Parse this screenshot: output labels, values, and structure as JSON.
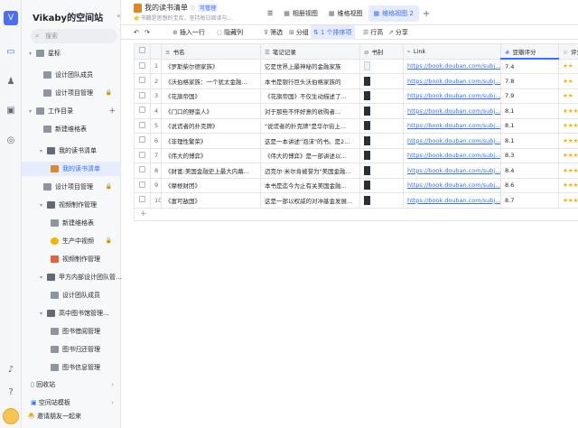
{
  "workspace": {
    "initial": "V",
    "title": "Vikaby的空间站",
    "search_placeholder": "搜索"
  },
  "sidebar": {
    "items": [
      {
        "label": "星标",
        "level": 0,
        "type": "group"
      },
      {
        "label": "设计团队成员",
        "level": 1,
        "type": "table"
      },
      {
        "label": "设计项目管理",
        "level": 1,
        "type": "table",
        "locked": true
      },
      {
        "label": "工作目录",
        "level": 0,
        "type": "group"
      },
      {
        "label": "新建维格表",
        "level": 1,
        "type": "table"
      },
      {
        "label": "我的读书清单",
        "level": 1,
        "type": "folder"
      },
      {
        "label": "我的读书清单",
        "level": 2,
        "type": "book",
        "selected": true
      },
      {
        "label": "设计项目管理",
        "level": 1,
        "type": "table",
        "locked": true
      },
      {
        "label": "视频制作管理",
        "level": 1,
        "type": "folder"
      },
      {
        "label": "新建维格表",
        "level": 2,
        "type": "table"
      },
      {
        "label": "生产中视频",
        "level": 2,
        "type": "emoji",
        "locked": true
      },
      {
        "label": "视频制作管理",
        "level": 2,
        "type": "thumb"
      },
      {
        "label": "甲方内部设计团队管...",
        "level": 1,
        "type": "folder"
      },
      {
        "label": "设计团队成员",
        "level": 2,
        "type": "table"
      },
      {
        "label": "高中图书馆管理...",
        "level": 1,
        "type": "folder"
      },
      {
        "label": "图书借阅管理",
        "level": 2,
        "type": "table"
      },
      {
        "label": "图书归还管理",
        "level": 2,
        "type": "table"
      },
      {
        "label": "图书信息管理",
        "level": 2,
        "type": "table"
      }
    ],
    "recycle_bin": "回收站",
    "templates": "空间站模板",
    "invite": "邀请朋友一起来"
  },
  "header": {
    "datasheet_name": "我的读书清单",
    "badge": "可管理",
    "description": "👉书籍是思想的宝库，坚持每日阅读与..."
  },
  "tabs": [
    {
      "label": "相册视图",
      "icon": "▦"
    },
    {
      "label": "维格视图",
      "icon": "▦"
    },
    {
      "label": "维格视图 2",
      "icon": "▦",
      "active": true
    }
  ],
  "toolbar": {
    "insert_row": "插入一行",
    "hidden_fields": "隐藏列",
    "filter": "筛选",
    "group": "分组",
    "sort": "1 个排序项",
    "row_height": "行高",
    "share": "分享"
  },
  "columns": [
    "书名",
    "笔记记录",
    "书封",
    "Link",
    "豆瓣评分",
    "评分"
  ],
  "rows": [
    {
      "n": "1",
      "title": "《罗斯柴尔德家族》",
      "note": "它是世界上最神秘的金融家族",
      "link": "https://book.douban.com/subj...",
      "score": "7.4",
      "stars": "★★",
      "cover": "c0"
    },
    {
      "n": "2",
      "title": "《沃伯格家族：一个犹太金融...",
      "note": "本书是银行巨头沃伯格家族的",
      "link": "https://book.douban.com/subj...",
      "score": "7.8",
      "stars": "★★",
      "cover": "c1"
    },
    {
      "n": "3",
      "title": "《花旗帝国》",
      "note": "《花旗帝国》不仅生动描述了...",
      "link": "https://book.douban.com/subj...",
      "score": "7.9",
      "stars": "★★",
      "cover": "c1"
    },
    {
      "n": "4",
      "title": "《门口的野蛮人》",
      "note": "对于那些不怀好意的收购者...",
      "link": "https://book.douban.com/subj...",
      "score": "8.1",
      "stars": "★★★",
      "cover": "c1"
    },
    {
      "n": "5",
      "title": "《说谎者的扑克牌》",
      "note": "\"说谎者的扑克牌\"是华尔街上...",
      "link": "https://book.douban.com/subj...",
      "score": "8.1",
      "stars": "★★★",
      "cover": "c1"
    },
    {
      "n": "6",
      "title": "《非理性繁荣》",
      "note": "这是一本讲述\"泡沫\"的书。是2...",
      "link": "https://book.douban.com/subj...",
      "score": "8.1",
      "stars": "★★★",
      "cover": "c1"
    },
    {
      "n": "7",
      "title": "《伟大的博弈》",
      "note": "《伟大的博弈》是一部讲述以...",
      "link": "https://book.douban.com/subj...",
      "score": "8.3",
      "stars": "★★★",
      "cover": "c1"
    },
    {
      "n": "8",
      "title": "《财富:美国金融史上最大内幕...",
      "note": "迈克尔·米尔肯被誉为\"美国金融...",
      "link": "https://book.douban.com/subj...",
      "score": "8.4",
      "stars": "★★★",
      "cover": "c1"
    },
    {
      "n": "9",
      "title": "《摩根财团》",
      "note": "本书是迄今为止有关美国金融...",
      "link": "https://book.douban.com/subj...",
      "score": "8.6",
      "stars": "★★★",
      "cover": "c1"
    },
    {
      "n": "10",
      "title": "《富可敌国》",
      "note": "这是一部以权威的对冲基金发展...",
      "link": "https://book.douban.com/subj...",
      "score": "8.7",
      "stars": "★★★",
      "cover": "c1"
    }
  ]
}
